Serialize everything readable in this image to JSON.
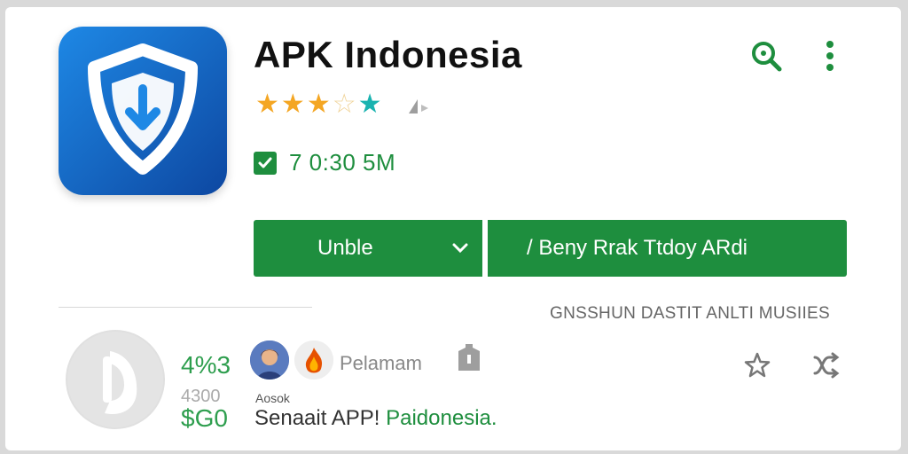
{
  "app": {
    "title": "APK Indonesia",
    "rating": 3.5,
    "meta": "7 0:30 5M",
    "primary_button": "Unblе",
    "secondary_button": "/ Beny Rrak Ttdoy ARdi",
    "section_label": "GNSSHUN DASTIT ANLTI MUSIIES"
  },
  "stats": {
    "primary": "4%3",
    "secondary": "4300",
    "price": "$G0"
  },
  "review": {
    "reviewer": "Pelamam",
    "tiny_label": "Aosok",
    "text_prefix": "Senaait APP! ",
    "text_brand": "Paidonesia."
  },
  "colors": {
    "accent": "#1e8e3e",
    "icon_blue": "#1565c0",
    "star": "#f4a623",
    "teal": "#1ab3b0"
  },
  "icons": [
    "shield-download-icon",
    "search-icon",
    "more-vert-icon",
    "check-icon",
    "chevron-down-icon",
    "star-outline-icon",
    "share-icon",
    "bookmark-icon"
  ]
}
